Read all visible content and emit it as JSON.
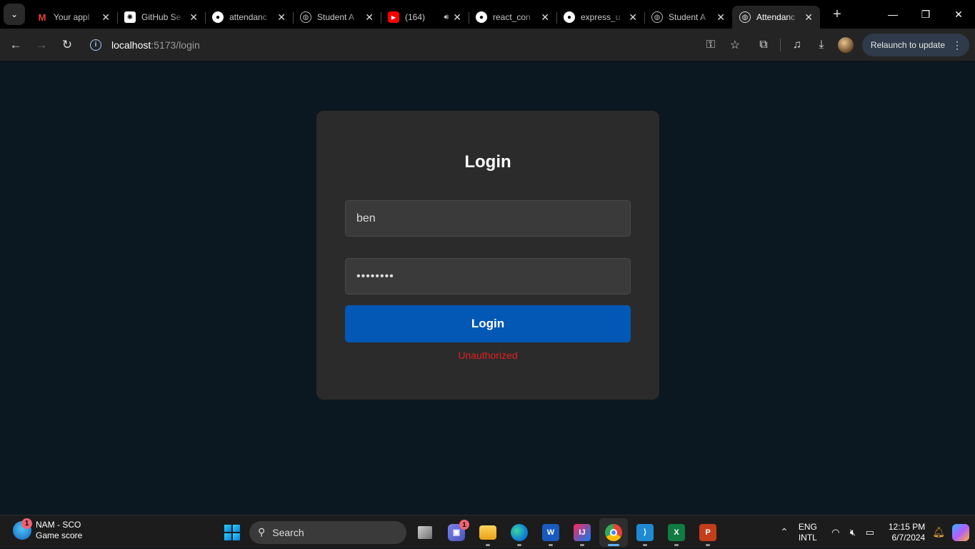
{
  "browser": {
    "tabs": [
      {
        "title": "Your appl",
        "favicon": "gmail-icon",
        "active": false,
        "audio": false
      },
      {
        "title": "GitHub Se",
        "favicon": "chatgpt-icon",
        "active": false,
        "audio": false
      },
      {
        "title": "attendanc",
        "favicon": "github-icon",
        "active": false,
        "audio": false
      },
      {
        "title": "Student A",
        "favicon": "globe-icon",
        "active": false,
        "audio": false
      },
      {
        "title": "(164)",
        "favicon": "youtube-icon",
        "active": false,
        "audio": true
      },
      {
        "title": "react_con",
        "favicon": "github-icon",
        "active": false,
        "audio": false
      },
      {
        "title": "express_u",
        "favicon": "github-icon",
        "active": false,
        "audio": false
      },
      {
        "title": "Student A",
        "favicon": "globe-icon",
        "active": false,
        "audio": false
      },
      {
        "title": "Attendanc",
        "favicon": "globe-icon",
        "active": true,
        "audio": false
      }
    ],
    "url_host": "localhost",
    "url_path": ":5173/login",
    "relaunch_label": "Relaunch to update"
  },
  "login": {
    "title": "Login",
    "username_value": "ben",
    "password_value": "benpassw",
    "button_label": "Login",
    "error_message": "Unauthorized",
    "error_color": "#e02020",
    "button_color": "#0358b5"
  },
  "taskbar": {
    "widget_title": "NAM - SCO",
    "widget_subtitle": "Game score",
    "widget_badge": "1",
    "search_label": "Search",
    "teams_badge": "1",
    "lang_line1": "ENG",
    "lang_line2": "INTL",
    "time": "12:15 PM",
    "date": "6/7/2024"
  }
}
